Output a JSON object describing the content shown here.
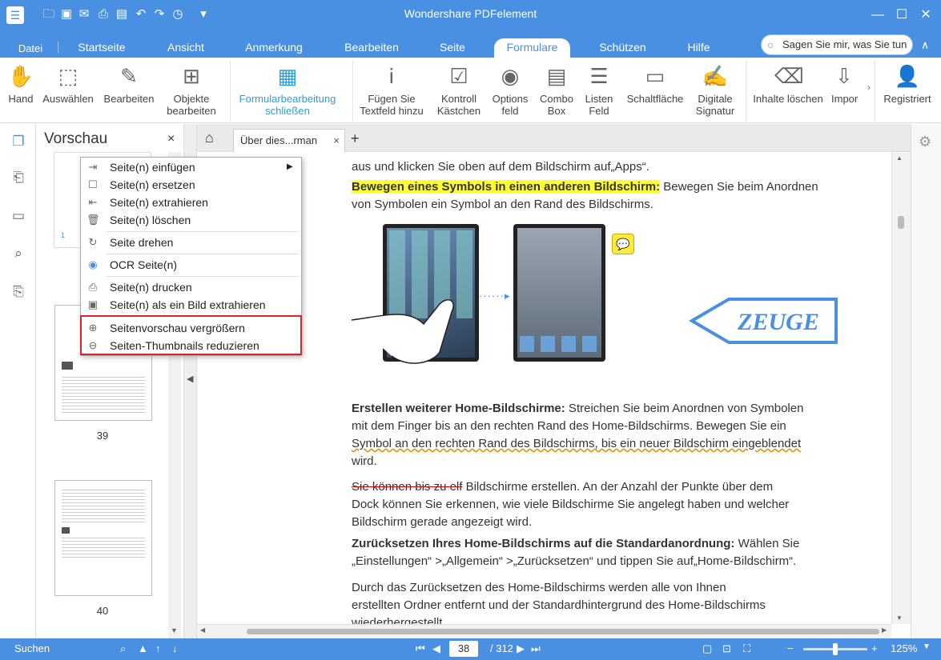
{
  "app": {
    "title": "Wondershare PDFelement"
  },
  "menu_tabs": [
    "Datei",
    "Startseite",
    "Ansicht",
    "Anmerkung",
    "Bearbeiten",
    "Seite",
    "Formulare",
    "Schützen",
    "Hilfe"
  ],
  "active_tab": "Formulare",
  "search": {
    "placeholder": "Sagen Sie mir, was Sie tun"
  },
  "ribbon": {
    "hand": "Hand",
    "select": "Auswählen",
    "edit": "Bearbeiten",
    "objects_l1": "Objekte",
    "objects_l2": "bearbeiten",
    "formedit_l1": "Formularbearbeitung",
    "formedit_l2": "schließen",
    "textfield_l1": "Fügen Sie",
    "textfield_l2": "Textfeld hinzu",
    "checkbox_l1": "Kontroll",
    "checkbox_l2": "Kästchen",
    "options_l1": "Options",
    "options_l2": "feld",
    "combo_l1": "Combo",
    "combo_l2": "Box",
    "list_l1": "Listen",
    "list_l2": "Feld",
    "button": "Schaltfläche",
    "sig_l1": "Digitale",
    "sig_l2": "Signatur",
    "clear": "Inhalte löschen",
    "import": "Impor",
    "registered": "Registriert"
  },
  "sidepanel": {
    "title": "Vorschau",
    "close": "×",
    "page_39": "39",
    "page_40": "40",
    "page_1": "1"
  },
  "doc_tab": {
    "label": "Über dies...rman",
    "close": "×",
    "add": "+"
  },
  "context_menu": {
    "insert": "Seite(n) einfügen",
    "replace": "Seite(n) ersetzen",
    "extract": "Seite(n) extrahieren",
    "delete": "Seite(n) löschen",
    "rotate": "Seite drehen",
    "ocr": "OCR Seite(n)",
    "print": "Seite(n) drucken",
    "extract_image": "Seite(n) als ein Bild extrahieren",
    "enlarge": "Seitenvorschau vergrößern",
    "reduce": "Seiten-Thumbnails reduzieren"
  },
  "document": {
    "line0": "aus und klicken Sie oben auf dem Bildschirm auf„Apps“.",
    "p1_head": "Bewegen eines Symbols in einen anderen Bildschirm:",
    "p1_rest": " Bewegen Sie beim Anordnen",
    "p1_line2": "von Symbolen ein Symbol an den Rand des Bildschirms.",
    "stamp": "ZEUGE",
    "p2_head": "Erstellen weiterer Home-Bildschirme:",
    "p2_l1": " Streichen Sie beim Anordnen von Symbolen",
    "p2_l2": "mit dem Finger bis an den rechten Rand des Home-Bildschirms. Bewegen Sie ein",
    "p2_l3": "Symbol an den rechten Rand des Bildschirms, bis ein neuer Bildschirm eingeblendet",
    "p2_l4": "wird.",
    "p3_strike": "Sie können bis zu elf",
    "p3_l1": " Bildschirme erstellen. An der Anzahl der Punkte über dem",
    "p3_l2": "Dock können Sie erkennen, wie viele Bildschirme Sie angelegt haben und welcher",
    "p3_l3": "Bildschirm gerade angezeigt wird.",
    "p4_head": "Zurücksetzen Ihres Home-Bildschirms auf die Standardanordnung:",
    "p4_l1": " Wählen Sie",
    "p4_l2": "„Einstellungen“ >„Allgemein“ >„Zurücksetzen“ und tippen Sie auf„Home-Bildschirm“.",
    "p5_l1": "Durch das Zurücksetzen des Home-Bildschirms werden alle von Ihnen",
    "p5_l2": "erstellten Ordner entfernt und der Standardhintergrund des Home-Bildschirms",
    "p5_l3": "wiederhergestellt."
  },
  "status": {
    "search": "Suchen",
    "page": "38",
    "total": "/ 312",
    "zoom": "125%"
  },
  "colors": {
    "accent": "#4a90e2",
    "highlight": "#ffff33",
    "stamp": "#4a90e2",
    "menu_box": "#d9252a"
  }
}
